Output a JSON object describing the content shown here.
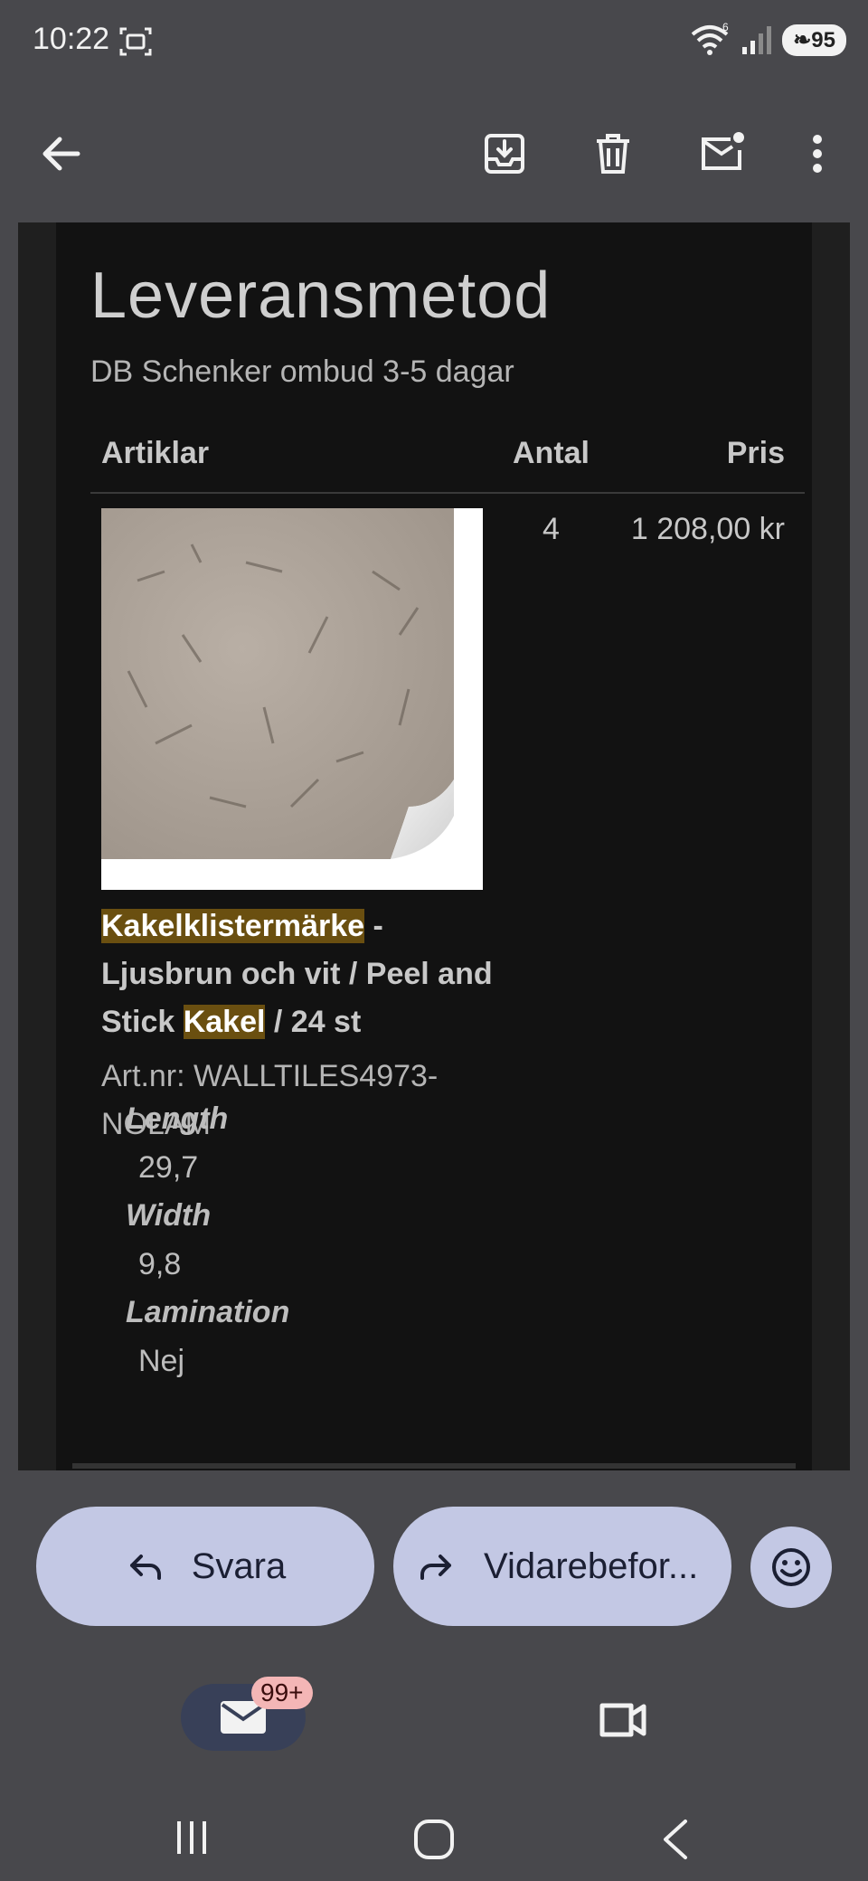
{
  "status_bar": {
    "time": "10:22",
    "battery": "95",
    "wifi_label": "6"
  },
  "email": {
    "shipping_title": "Leveransmetod",
    "shipping_method": "DB Schenker ombud 3-5 dagar",
    "table": {
      "headers": {
        "articles": "Artiklar",
        "quantity": "Antal",
        "price": "Pris"
      },
      "row": {
        "quantity": "4",
        "price": "1 208,00 kr",
        "name_parts": [
          "Kakelklistermärke",
          " - Ljusbrun och vit / Peel and Stick ",
          "Kakel",
          " / 24 st"
        ],
        "art_nr": "Art.nr: WALLTILES4973-NOLAM",
        "attributes": [
          {
            "key": "Length",
            "value": "29,7"
          },
          {
            "key": "Width",
            "value": "9,8"
          },
          {
            "key": "Lamination",
            "value": "Nej"
          }
        ]
      }
    }
  },
  "actions": {
    "reply_label": "Svara",
    "forward_label": "Vidarebefor..."
  },
  "bottom_nav": {
    "mail_badge": "99+"
  },
  "colors": {
    "highlight": "#6a4f10",
    "pill": "#c3c8e4",
    "background": "#48484c",
    "email_bg": "#121212"
  }
}
